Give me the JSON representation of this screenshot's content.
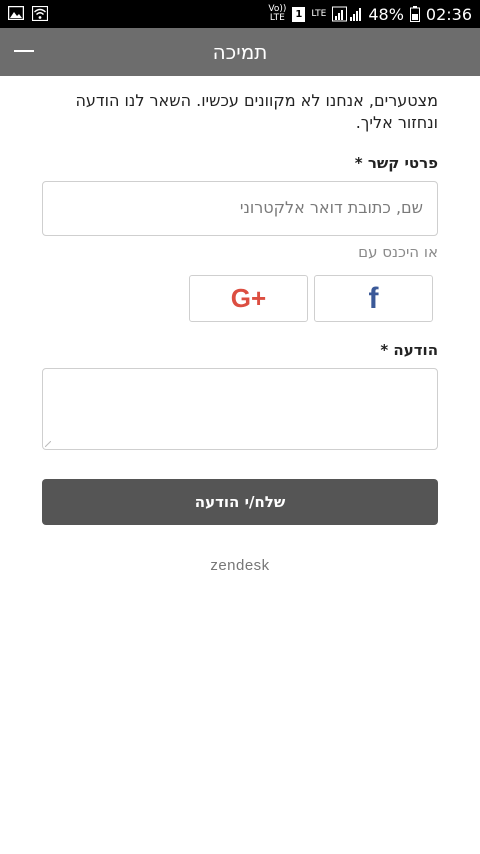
{
  "status_bar": {
    "volte_top": "Vo))",
    "volte_bottom": "LTE",
    "sim_badge": "1",
    "lte": "LTE",
    "battery": "48%",
    "time": "02:36"
  },
  "app_bar": {
    "title": "תמיכה"
  },
  "form": {
    "intro": "מצטערים, אנחנו לא מקוונים עכשיו. השאר לנו הודעה ונחזור אליך.",
    "contact_label": "פרטי קשר *",
    "contact_placeholder": "שם, כתובת דואר אלקטרוני",
    "signin_with": "או היכנס עם",
    "facebook_glyph": "f",
    "google_glyph": "G+",
    "message_label": "הודעה *",
    "submit_label": "שלח/י הודעה"
  },
  "footer": {
    "brand": "zendesk"
  },
  "colors": {
    "app_bar": "#6d6d6d",
    "submit_button": "#555555",
    "facebook": "#3b5998",
    "google_plus": "#dc4e41"
  },
  "icons": [
    "image-icon",
    "wifi-icon",
    "sim-icon",
    "signal-icon",
    "battery-icon",
    "menu-icon",
    "facebook-icon",
    "google-plus-icon",
    "resize-handle-icon"
  ]
}
